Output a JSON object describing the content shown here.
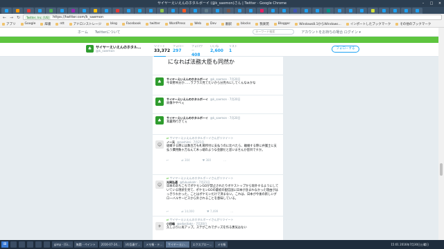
{
  "window": {
    "title": "サイヤーえいえんのホタルボーイ (@k_saemon)さん | Twitter - Google Chrome",
    "minimize": "–",
    "maximize": "□",
    "close": "×"
  },
  "tabs": [
    {
      "color": "#1da1f2"
    },
    {
      "color": "#ff9800"
    },
    {
      "color": "#e53935"
    },
    {
      "color": "#1da1f2"
    },
    {
      "color": "#4caf50"
    },
    {
      "color": "#1da1f2"
    },
    {
      "color": "#9c27b0"
    },
    {
      "color": "#1da1f2"
    },
    {
      "color": "#ffc107"
    },
    {
      "color": "#1da1f2"
    },
    {
      "color": "#e53935"
    },
    {
      "color": "#1da1f2"
    },
    {
      "color": "#03a9f4"
    },
    {
      "color": "#1da1f2"
    },
    {
      "color": "#8bc34a"
    },
    {
      "color": "#1da1f2"
    },
    {
      "color": "#ff5722"
    },
    {
      "color": "#1da1f2"
    },
    {
      "color": "#607d8b"
    },
    {
      "color": "#1da1f2"
    },
    {
      "color": "#795548"
    },
    {
      "color": "#1da1f2"
    },
    {
      "color": "#1da1f2"
    },
    {
      "color": "#e91e63"
    },
    {
      "color": "#1da1f2"
    },
    {
      "color": "#1da1f2"
    },
    {
      "color": "#3f51b5"
    },
    {
      "color": "#1da1f2"
    },
    {
      "color": "#1da1f2"
    },
    {
      "color": "#009688"
    },
    {
      "color": "#1da1f2"
    },
    {
      "color": "#1da1f2"
    },
    {
      "color": "#1da1f2"
    },
    {
      "color": "#cddc39"
    },
    {
      "color": "#1da1f2"
    },
    {
      "color": "#1da1f2"
    },
    {
      "color": "#1da1f2"
    },
    {
      "color": "#1da1f2"
    }
  ],
  "address": {
    "back": "←",
    "forward": "→",
    "reload": "↻",
    "secure": "Twitter, Inc. [US]",
    "url": "https://twitter.com/k_saemon"
  },
  "bookmarks": [
    "アプリ",
    "Google",
    "辞書",
    "ntt",
    "アドロンストレージ",
    "blog",
    "Facebook",
    "twitter",
    "WordPress",
    "Web",
    "Dev",
    "翻訳",
    "blocks",
    "我楽苑",
    "Blogger",
    "Windows8.1からWindows...",
    "インポートしたブックマーク",
    "その他のブックマーク"
  ],
  "twnav": {
    "home": "ホーム",
    "about": "Twitterについて",
    "search_placeholder": "キーワード検索",
    "login": "アカウントをお持ちの場合 ログイン ▾"
  },
  "profile": {
    "name": "サイヤーえいえんのホタル...",
    "handle": "@k_saemon",
    "stats": [
      {
        "label": "ツイート",
        "value": "33,372"
      },
      {
        "label": "フォロー",
        "value": "297"
      },
      {
        "label": "フォロワー",
        "value": "408"
      },
      {
        "label": "いいね",
        "value": "2,600"
      },
      {
        "label": "リスト",
        "value": "1"
      }
    ],
    "follow": "フォローする"
  },
  "timeline": {
    "top_text": "になれば法務大臣も同然か",
    "tweets": [
      {
        "rt": "",
        "name": "サイヤーえいえんのホタルボーイ",
        "meta": "@k_saemon · 7月20日",
        "text": "今日野木分か……ラブラス見てたいから分見れにしてくんなぁかな",
        "avatar": "♣"
      },
      {
        "rt": "",
        "name": "サイヤーえいえんのホタルボーイ",
        "meta": "@k_saemon · 7月20日",
        "text": "肩傷ややべぇ",
        "avatar": "♣"
      },
      {
        "rt": "",
        "name": "サイヤーえいえんのホタルボーイ",
        "meta": "@k_saemon · 7月20日",
        "text": "耳裏時行きてぇ",
        "avatar": "♣"
      },
      {
        "rt": "サイヤーえいえんのホタルボーイさんがリツイート",
        "name": "ノー元",
        "meta": "@noshirei · 7月21日",
        "text": "組織する際には数百万も札場所付に支払うのに比べたら、離婚する際に弁護士に支払う費用数十万なんて木っ端のような金額だと思いませんか皆目ですか。",
        "avatar": "☺",
        "acts": [
          "↩",
          "⇄ 304",
          "♥ 380",
          "…"
        ]
      },
      {
        "rt": "サイヤーえいえんのホタルボーイさんがリツイート",
        "name": "光岡弘通",
        "meta": "@fukuokahr · 7月21日",
        "text": "日本のあちこちでポケモンGOが禁止されたりボケストップから除外するようにしていている現状を見て、ポケモンGOの最初の配信国に日本が含まれなかった理由がはっきりわかった。ことはポケモンだけで済まない。これは、日本が今後の新しいグローバルサービスから外されることを意味している。",
        "avatar": "☺",
        "acts": [
          "↩",
          "⇄ 14,000",
          "♥ 7,499",
          "…"
        ]
      },
      {
        "rt": "サイヤーえいえんのホタルボーイさんがリツイート",
        "name": "小田嶋",
        "meta": "@odasitakn · 7月20日",
        "text": "久しぶりに再アップ。ステがこれでグッズを作る勇気はない",
        "avatar": "✈"
      }
    ]
  },
  "taskbar": {
    "start": "⊞",
    "apps": [
      "gimp - [Gi...",
      "無題 - ペイント",
      "2016-07-24...",
      "(4)吾妻ゲ...",
      "メモ帳 - テ...",
      "サイヤーえい...",
      "エクスプロー...",
      "メモ帳"
    ]
  },
  "clock": "15:01  2016年7月30日土曜日"
}
